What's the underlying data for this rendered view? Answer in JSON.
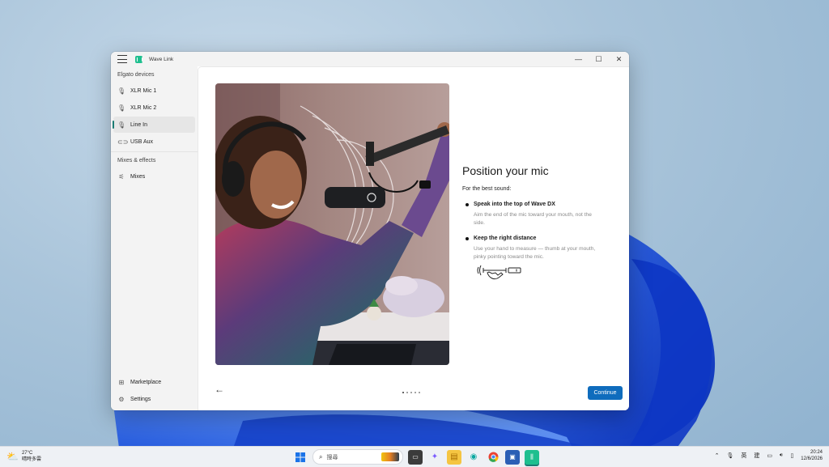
{
  "window": {
    "app_title": "Wave Link",
    "controls": {
      "minimize": "—",
      "maximize": "☐",
      "close": "✕"
    }
  },
  "sidebar": {
    "devices_header": "Elgato devices",
    "devices": [
      {
        "label": "XLR Mic 1",
        "icon": "microphone-icon"
      },
      {
        "label": "XLR Mic 2",
        "icon": "microphone-icon"
      },
      {
        "label": "Line In",
        "icon": "microphone-icon",
        "active": true
      },
      {
        "label": "USB Aux",
        "icon": "link-icon"
      }
    ],
    "effects_header": "Mixes & effects",
    "mixes_label": "Mixes",
    "marketplace_label": "Marketplace",
    "settings_label": "Settings"
  },
  "main": {
    "heading": "Position your mic",
    "subtitle": "For the best sound:",
    "tips": [
      {
        "title": "Speak into the top of Wave DX",
        "body": "Aim the end of the mic toward your mouth, not the side."
      },
      {
        "title": "Keep the right distance",
        "body": "Use your hand to measure — thumb at your mouth, pinky pointing toward the mic."
      }
    ],
    "back_icon": "←",
    "pager": {
      "count": 5,
      "active": 0
    },
    "continue_label": "Continue"
  },
  "taskbar": {
    "weather_temp": "27°C",
    "weather_desc": "晴時多雲",
    "search_placeholder": "搜尋",
    "tray": {
      "ime": "英",
      "ime2": "建"
    },
    "time": "20:24",
    "date": "12/6/2026"
  },
  "colors": {
    "accent": "#0f6cbd",
    "active_indicator": "#1c7c74",
    "app_logo": "#1fbf8f"
  }
}
